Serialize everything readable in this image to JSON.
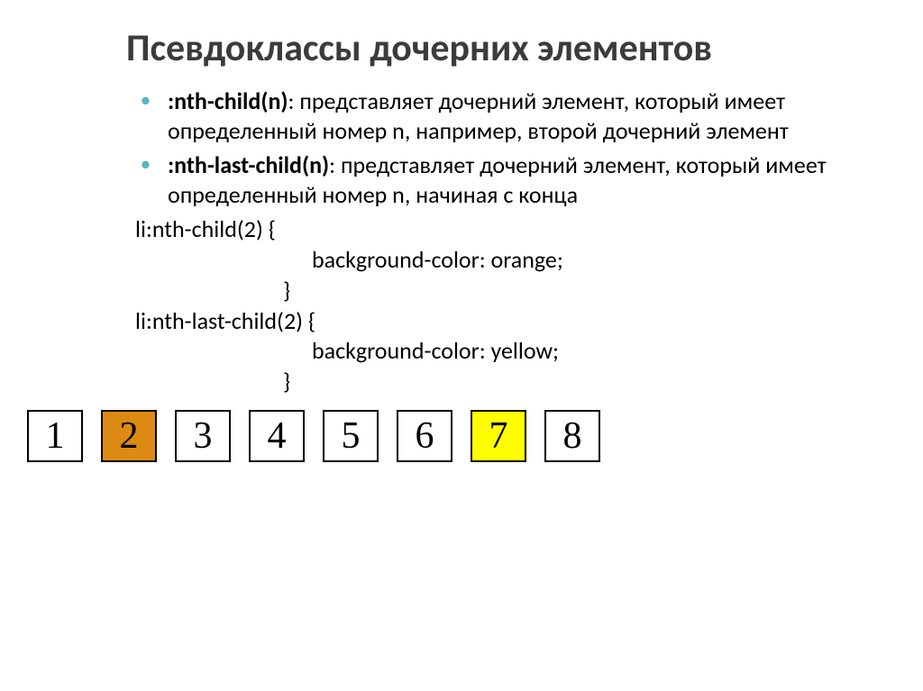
{
  "title": "Псевдоклассы дочерних элементов",
  "bullets": [
    {
      "term": ":nth-child(n)",
      "desc": ": представляет дочерний элемент, который имеет определенный номер n, например, второй дочерний элемент"
    },
    {
      "term": ":nth-last-child(n)",
      "desc": ": представляет дочерний элемент, который имеет определенный номер n, начиная с конца"
    }
  ],
  "code": {
    "line1": "li:nth-child(2) {",
    "line2": "background-color: orange;",
    "line3": "}",
    "line4": "li:nth-last-child(2) {",
    "line5": "background-color: yellow;",
    "line6": "}"
  },
  "boxes": [
    {
      "n": "1",
      "cls": ""
    },
    {
      "n": "2",
      "cls": "orange"
    },
    {
      "n": "3",
      "cls": ""
    },
    {
      "n": "4",
      "cls": ""
    },
    {
      "n": "5",
      "cls": ""
    },
    {
      "n": "6",
      "cls": ""
    },
    {
      "n": "7",
      "cls": "yellow"
    },
    {
      "n": "8",
      "cls": ""
    }
  ]
}
